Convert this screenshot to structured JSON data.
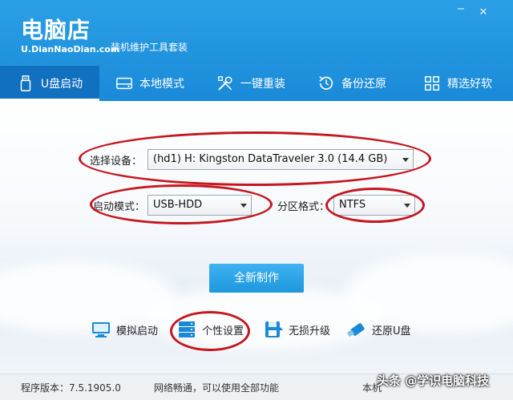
{
  "app": {
    "logo_main": "电脑店",
    "logo_url": "U.DianNaoDian.com",
    "logo_sub": "装机维护工具套装",
    "minimize": "−",
    "close": "✕"
  },
  "tabs": [
    {
      "label": "U盘启动",
      "icon": "usb-drive-icon",
      "active": true
    },
    {
      "label": "本地模式",
      "icon": "hard-disk-icon",
      "active": false
    },
    {
      "label": "一键重装",
      "icon": "tools-icon",
      "active": false
    },
    {
      "label": "备份还原",
      "icon": "backup-restore-icon",
      "active": false
    },
    {
      "label": "精选好软",
      "icon": "apps-grid-icon",
      "active": false
    }
  ],
  "form": {
    "device_label": "选择设备：",
    "device_value": "(hd1) H: Kingston DataTraveler 3.0 (14.4 GB)",
    "boot_label": "启动模式：",
    "boot_value": "USB-HDD",
    "partition_label": "分区格式：",
    "partition_value": "NTFS",
    "make_button": "全新制作"
  },
  "tools": [
    {
      "label": "模拟启动",
      "icon": "monitor-icon"
    },
    {
      "label": "个性设置",
      "icon": "settings-server-icon"
    },
    {
      "label": "无损升级",
      "icon": "save-upgrade-icon"
    },
    {
      "label": "还原U盘",
      "icon": "usb-restore-icon"
    }
  ],
  "status": {
    "version": "程序版本：7.5.1905.0",
    "network": "网络畅通，可以使用全部功能",
    "right_text": "本机"
  },
  "watermark": "头条 @学识电脑科技",
  "colors": {
    "header_blue": "#1a8ad8",
    "active_tab": "#1170c0",
    "button_blue": "#1e97de",
    "annotation_red": "#c6161f"
  }
}
